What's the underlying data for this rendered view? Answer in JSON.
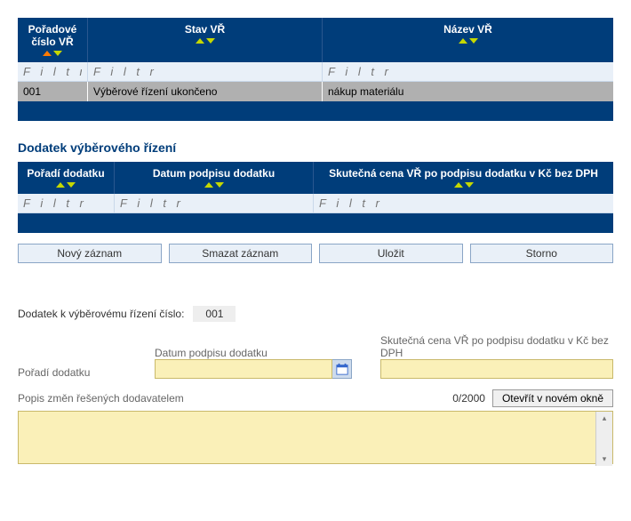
{
  "filter_placeholder": "F i l t r",
  "table1": {
    "headers": {
      "order": "Pořadové číslo VŘ",
      "state": "Stav VŘ",
      "name": "Název VŘ"
    },
    "row": {
      "order": "001",
      "state": "Výběrové řízení ukončeno",
      "name": "nákup materiálu"
    }
  },
  "section_title": "Dodatek výběrového řízení",
  "table2": {
    "headers": {
      "order": "Pořadí dodatku",
      "date": "Datum podpisu dodatku",
      "price": "Skutečná cena VŘ po podpisu dodatku\\nv Kč bez DPH"
    }
  },
  "buttons": {
    "new": "Nový záznam",
    "del": "Smazat záznam",
    "save": "Uložit",
    "cancel": "Storno"
  },
  "form": {
    "title": "Dodatek k výběrovému řízení číslo:",
    "number": "001",
    "labels": {
      "order": "Pořadí dodatku",
      "date": "Datum podpisu dodatku",
      "price": "Skutečná cena VŘ po podpisu dodatku v Kč bez DPH",
      "desc": "Popis změn řešených dodavatelem"
    },
    "counter": "0/2000",
    "open": "Otevřít v novém okně"
  }
}
